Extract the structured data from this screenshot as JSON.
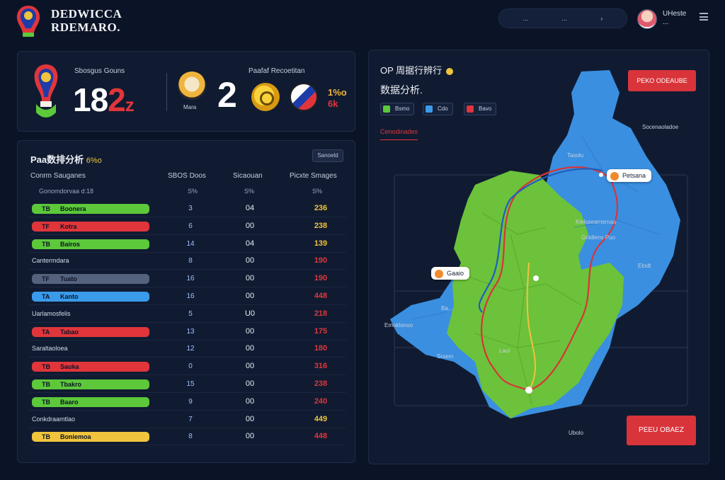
{
  "header": {
    "brand_line1": "DEDWICCA",
    "brand_line2": "RDEMARO.",
    "nav_item_1": "...",
    "nav_item_2": "...",
    "username": "UHeste",
    "username_sub": "..."
  },
  "score_panel": {
    "label": "Sbosgus Gouns",
    "score_main": "18",
    "score_red": "2",
    "score_suffix": "z",
    "mascot_label": "Mara",
    "mid_label": "Paafaf Recoetitan",
    "mid_value": "2",
    "side_value_1": "1%o",
    "side_value_2": "6k"
  },
  "table_panel": {
    "title": "Paa数排分析",
    "title_hl": "6%o",
    "button_label": "Sanoeld",
    "headers": [
      "Conrm Sauganes",
      "SBOS Doos",
      "Sicaouan",
      "Picxte Smages"
    ],
    "subheaders": [
      "Gonomdorvaa d:18",
      "S%",
      "S%",
      "S%"
    ],
    "rows": [
      {
        "type": "pill",
        "color": "#5cc83a",
        "code": "TB",
        "name": "Boonera",
        "c1": "3",
        "c2": "04",
        "c3": "236",
        "c3_color": "#f0c43c"
      },
      {
        "type": "pill",
        "color": "#e0363b",
        "code": "TF",
        "name": "Kotra",
        "c1": "6",
        "c2": "00",
        "c3": "238",
        "c3_color": "#f0c43c"
      },
      {
        "type": "pill",
        "color": "#5cc83a",
        "code": "TB",
        "name": "Bairos",
        "c1": "14",
        "c2": "04",
        "c3": "139",
        "c3_color": "#f0c43c"
      },
      {
        "type": "plain",
        "name": "Cantermdara",
        "c1": "8",
        "c2": "00",
        "c3": "190",
        "c3_color": "#e0363b"
      },
      {
        "type": "pill",
        "color": "#55627e",
        "code": "TF",
        "name": "Tuato",
        "c1": "16",
        "c2": "00",
        "c3": "190",
        "c3_color": "#e0363b"
      },
      {
        "type": "pill",
        "color": "#3a9bea",
        "code": "TA",
        "name": "Kanto",
        "c1": "16",
        "c2": "00",
        "c3": "448",
        "c3_color": "#e0363b"
      },
      {
        "type": "plain",
        "name": "Uarlamosfelis",
        "c1": "5",
        "c2": "U0",
        "c3": "218",
        "c3_color": "#e0363b"
      },
      {
        "type": "pill",
        "color": "#e0363b",
        "code": "TA",
        "name": "Tabao",
        "c1": "13",
        "c2": "00",
        "c3": "175",
        "c3_color": "#e0363b"
      },
      {
        "type": "plain",
        "name": "Saraltaoloea",
        "c1": "12",
        "c2": "00",
        "c3": "180",
        "c3_color": "#e0363b"
      },
      {
        "type": "pill",
        "color": "#e0363b",
        "code": "TB",
        "name": "Sauka",
        "c1": "0",
        "c2": "00",
        "c3": "316",
        "c3_color": "#e0363b"
      },
      {
        "type": "pill",
        "color": "#5cc83a",
        "code": "TB",
        "name": "Tbakro",
        "c1": "15",
        "c2": "00",
        "c3": "238",
        "c3_color": "#e0363b"
      },
      {
        "type": "pill",
        "color": "#5cc83a",
        "code": "TB",
        "name": "Baaro",
        "c1": "9",
        "c2": "00",
        "c3": "240",
        "c3_color": "#e0363b"
      },
      {
        "type": "plain",
        "name": "Conkdraamtlao",
        "c1": "7",
        "c2": "00",
        "c3": "449",
        "c3_color": "#f0c43c"
      },
      {
        "type": "pill",
        "color": "#f0c43c",
        "code": "TB",
        "name": "Boniemoa",
        "c1": "8",
        "c2": "00",
        "c3": "448",
        "c3_color": "#e0363b"
      }
    ]
  },
  "map_panel": {
    "title1": "OP 周据行辨行",
    "title2": "数据分析.",
    "chips": [
      {
        "label": "Bsmo",
        "color": "#5cc83a"
      },
      {
        "label": "Cdo",
        "color": "#3a9bea"
      },
      {
        "label": "Bavo",
        "color": "#e0363b"
      }
    ],
    "tab_label": "Cenodinades",
    "top_button": "PEKO ODEAUBE",
    "bottom_button": "PEEU OBAEZ",
    "callout_1": "Petsana",
    "callout_2": "Gaaio",
    "label_1": "Tasolu",
    "label_2": "Socenaoladoe",
    "label_3": "Kieloseamemao",
    "label_4": "Gnidlens Puo",
    "label_5": "Elodt",
    "label_6": "Ba...",
    "label_7": "Emoklonoo",
    "label_8": "Srxem",
    "label_9": "Laul",
    "label_10": "Ubolo"
  },
  "colors": {
    "background": "#0b1426",
    "panel": "#101b31",
    "accent_red": "#d8343a",
    "map_green": "#6cc23a",
    "map_blue": "#3a8fe0"
  }
}
